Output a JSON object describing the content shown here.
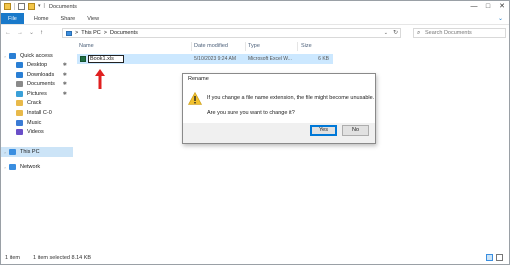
{
  "title_bar": {
    "title": "Documents",
    "qat_extra": "|",
    "window_buttons": {
      "minimize": "—",
      "maximize": "□",
      "close": "✕"
    }
  },
  "ribbon": {
    "tabs": [
      "File",
      "Home",
      "Share",
      "View"
    ],
    "expand_icon": "⌄",
    "help_icon": "?"
  },
  "address": {
    "path": [
      "This PC",
      "Documents"
    ],
    "separator": ">",
    "search_placeholder": "Search Documents",
    "nav_buttons": {
      "back": "←",
      "forward": "→",
      "recent": "⌄",
      "up": "↑"
    }
  },
  "nav_pane": {
    "items": [
      {
        "label": "Quick access",
        "icon": "star-icon",
        "color": "#2a7fd4",
        "pinned": false,
        "level": 0
      },
      {
        "label": "Desktop",
        "icon": "desktop-icon",
        "color": "#2a7fd4",
        "pinned": true,
        "level": 1
      },
      {
        "label": "Downloads",
        "icon": "download-icon",
        "color": "#2a7fd4",
        "pinned": true,
        "level": 1
      },
      {
        "label": "Documents",
        "icon": "documents-icon",
        "color": "#8a8a8a",
        "pinned": true,
        "level": 1
      },
      {
        "label": "Pictures",
        "icon": "pictures-icon",
        "color": "#3aa0d8",
        "pinned": true,
        "level": 1
      },
      {
        "label": "Crack",
        "icon": "folder-icon",
        "color": "#e8b94a",
        "pinned": false,
        "level": 1
      },
      {
        "label": "Install C-0",
        "icon": "folder-icon",
        "color": "#e8b94a",
        "pinned": false,
        "level": 1
      },
      {
        "label": "Music",
        "icon": "music-icon",
        "color": "#3a7bd5",
        "pinned": false,
        "level": 1
      },
      {
        "label": "Videos",
        "icon": "videos-icon",
        "color": "#6a4fc8",
        "pinned": false,
        "level": 1
      },
      {
        "label": "This PC",
        "icon": "computer-icon",
        "color": "#3a8ee0",
        "pinned": false,
        "level": 0,
        "selected": true
      },
      {
        "label": "Network",
        "icon": "network-icon",
        "color": "#3a8ee0",
        "pinned": false,
        "level": 0
      }
    ],
    "pin_glyph": "✱"
  },
  "columns": [
    "Name",
    "Date modified",
    "Type",
    "Size"
  ],
  "file": {
    "name_edit": "Book1.xls",
    "date_modified": "5/10/2023 9:24 AM",
    "type": "Microsoft Excel W...",
    "size": "6 KB"
  },
  "dialog": {
    "title": "Rename",
    "message": "If you change a file name extension, the file might become unusable.",
    "question": "Are you sure you want to change it?",
    "yes_label": "Yes",
    "no_label": "No"
  },
  "status_bar": {
    "item_count": "1 item",
    "selected": "1 item selected  8.14 KB"
  },
  "colors": {
    "accent": "#1979ca",
    "selection": "#cce8ff",
    "arrow": "#e02020",
    "warning": "#f2c12e"
  }
}
